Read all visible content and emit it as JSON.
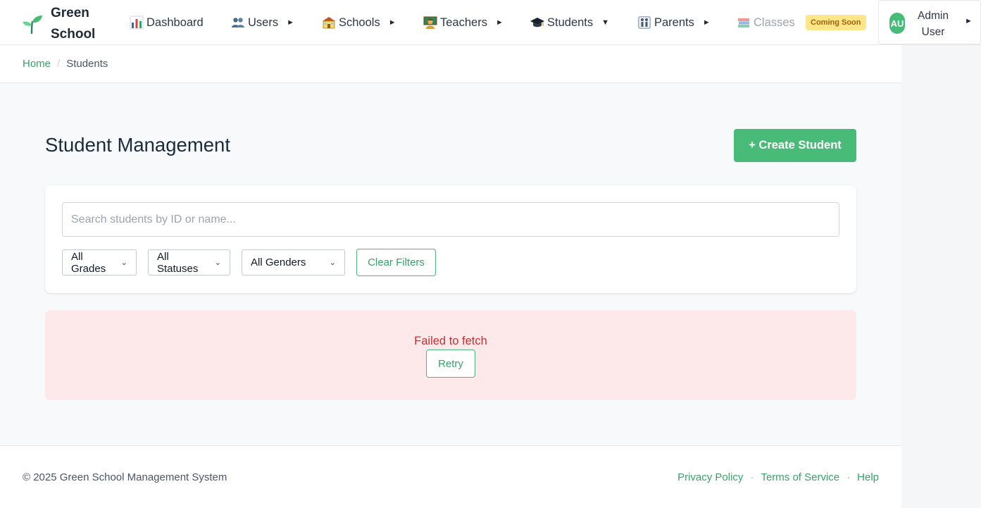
{
  "brand": {
    "name": "Green School",
    "icon": "sprout-icon"
  },
  "nav": {
    "items": [
      {
        "label": "Dashboard",
        "icon": "bar-chart-icon",
        "has_caret": false
      },
      {
        "label": "Users",
        "icon": "people-icon",
        "has_caret": true
      },
      {
        "label": "Schools",
        "icon": "school-building-icon",
        "has_caret": true
      },
      {
        "label": "Teachers",
        "icon": "teacher-icon",
        "has_caret": true
      },
      {
        "label": "Students",
        "icon": "graduation-cap-icon",
        "has_caret": true,
        "expanded": true
      },
      {
        "label": "Parents",
        "icon": "family-icon",
        "has_caret": true
      },
      {
        "label": "Classes",
        "icon": "books-icon",
        "disabled": true
      }
    ],
    "coming_soon_badge": "Coming Soon",
    "caret_right": "►",
    "caret_down": "▼"
  },
  "user": {
    "initials": "AU",
    "name": "Admin User"
  },
  "breadcrumb": {
    "home": "Home",
    "separator": "/",
    "current": "Students"
  },
  "page": {
    "title": "Student Management",
    "create_button": "+ Create Student"
  },
  "filters": {
    "search_placeholder": "Search students by ID or name...",
    "grade": "All Grades",
    "status": "All Statuses",
    "gender": "All Genders",
    "clear_button": "Clear Filters"
  },
  "error": {
    "message": "Failed to fetch",
    "retry_button": "Retry"
  },
  "footer": {
    "copyright": "© 2025 Green School Management System",
    "links": [
      "Privacy Policy",
      "Terms of Service",
      "Help"
    ],
    "separator": "·"
  },
  "colors": {
    "accent": "#48bb78",
    "accent_text": "#38a169",
    "error_bg": "#fde8ea",
    "error_text": "#c53030",
    "badge_bg": "#fde68a"
  }
}
